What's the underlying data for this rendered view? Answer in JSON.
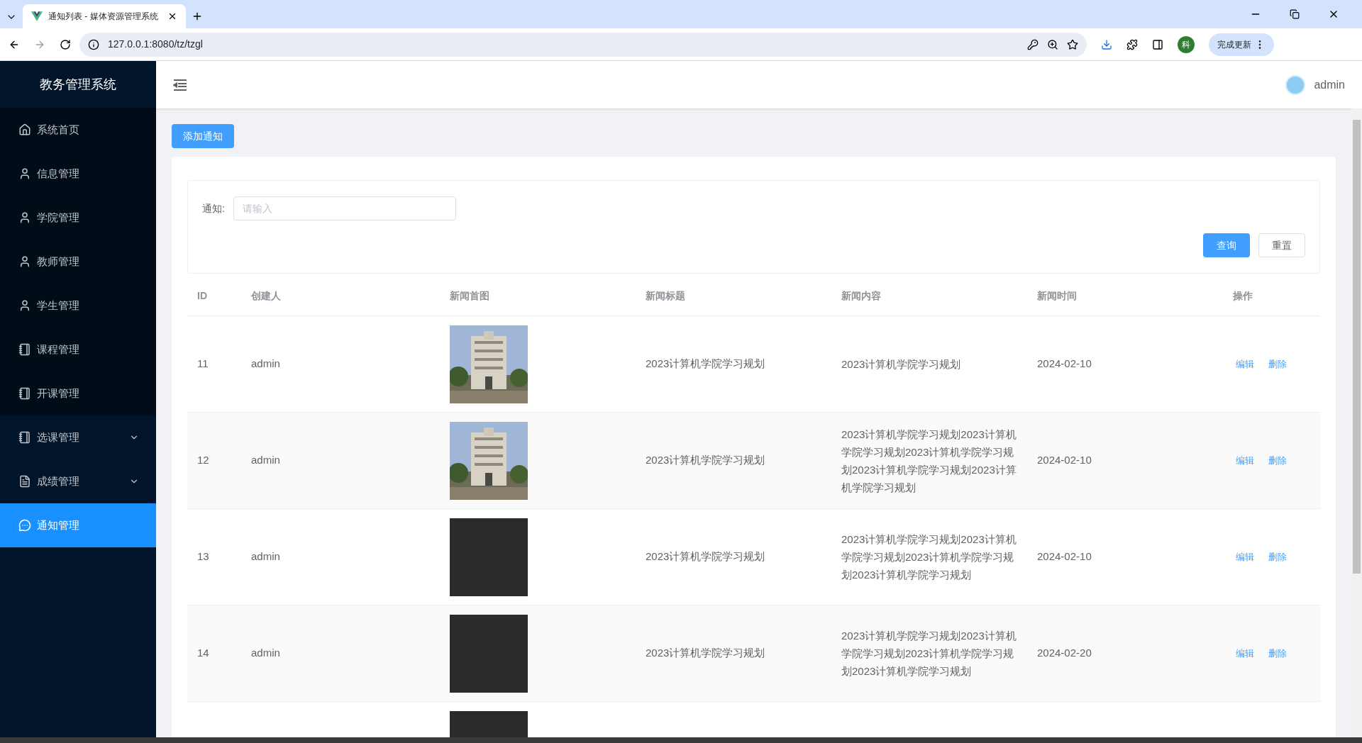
{
  "browser": {
    "tab_title": "通知列表 - 媒体资源管理系统",
    "url": "127.0.0.1:8080/tz/tzgl",
    "profile_initial": "科",
    "update_button": "完成更新"
  },
  "sidebar": {
    "title": "教务管理系统",
    "items": [
      {
        "label": "系统首页",
        "kind": "home",
        "expandable": false,
        "selected": false
      },
      {
        "label": "信息管理",
        "kind": "user",
        "expandable": false,
        "selected": false
      },
      {
        "label": "学院管理",
        "kind": "user",
        "expandable": false,
        "selected": false
      },
      {
        "label": "教师管理",
        "kind": "user",
        "expandable": false,
        "selected": false
      },
      {
        "label": "学生管理",
        "kind": "user",
        "expandable": false,
        "selected": false
      },
      {
        "label": "课程管理",
        "kind": "notebook",
        "expandable": false,
        "selected": false
      },
      {
        "label": "开课管理",
        "kind": "notebook",
        "expandable": false,
        "selected": false
      },
      {
        "label": "选课管理",
        "kind": "notebook",
        "expandable": true,
        "selected": false
      },
      {
        "label": "成绩管理",
        "kind": "document",
        "expandable": true,
        "selected": false
      },
      {
        "label": "通知管理",
        "kind": "chat",
        "expandable": false,
        "selected": true
      }
    ]
  },
  "header": {
    "user": "admin"
  },
  "add_button": "添加通知",
  "search": {
    "label": "通知:",
    "placeholder": "请输入",
    "query_button": "查询",
    "reset_button": "重置"
  },
  "table": {
    "columns": [
      "ID",
      "创建人",
      "新闻首图",
      "新闻标题",
      "新闻内容",
      "新闻时间",
      "操作"
    ],
    "rows": [
      {
        "id": "11",
        "creator": "admin",
        "title": "2023计算机学院学习规划",
        "content": "2023计算机学院学习规划",
        "time": "2024-02-10",
        "actions": [
          "编辑",
          "删除"
        ]
      },
      {
        "id": "12",
        "creator": "admin",
        "title": "2023计算机学院学习规划",
        "content": "2023计算机学院学习规划2023计算机学院学习规划2023计算机学院学习规划2023计算机学院学习规划2023计算机学院学习规划",
        "time": "2024-02-10",
        "actions": [
          "编辑",
          "删除"
        ]
      },
      {
        "id": "13",
        "creator": "admin",
        "image": {
          "kind": "blank"
        },
        "title": "2023计算机学院学习规划",
        "content": "2023计算机学院学习规划2023计算机学院学习规划2023计算机学院学习规划2023计算机学院学习规划",
        "time": "2024-02-10",
        "actions": [
          "编辑",
          "删除"
        ]
      },
      {
        "id": "14",
        "creator": "admin",
        "image": {
          "kind": "blank"
        },
        "title": "2023计算机学院学习规划",
        "content": "2023计算机学院学习规划2023计算机学院学习规划2023计算机学院学习规划2023计算机学院学习规划",
        "time": "2024-02-20",
        "actions": [
          "编辑",
          "删除"
        ]
      },
      {
        "image": {
          "kind": "blank"
        }
      }
    ]
  }
}
